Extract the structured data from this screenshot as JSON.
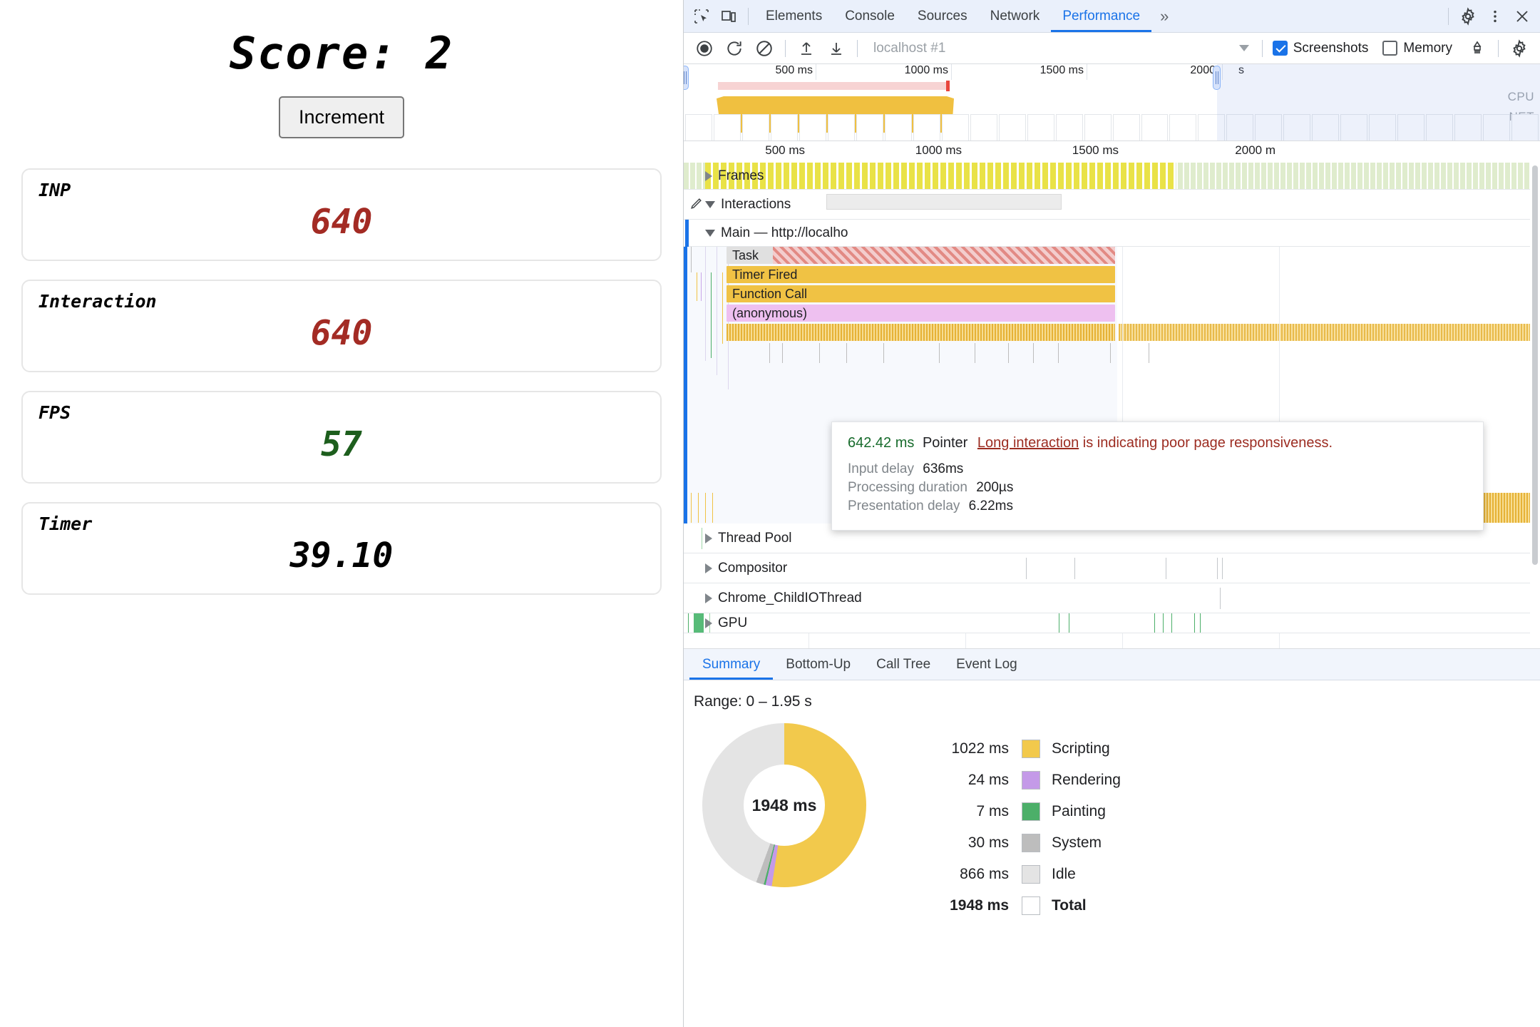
{
  "page": {
    "score_title": "Score: 2",
    "increment_label": "Increment",
    "metrics": [
      {
        "label": "INP",
        "value": "640",
        "color": "#a32b24"
      },
      {
        "label": "Interaction",
        "value": "640",
        "color": "#a32b24"
      },
      {
        "label": "FPS",
        "value": "57",
        "color": "#1d5e1d"
      },
      {
        "label": "Timer",
        "value": "39.10",
        "color": "#000000"
      }
    ]
  },
  "devtools": {
    "tabs": [
      {
        "label": "Elements",
        "active": false
      },
      {
        "label": "Console",
        "active": false
      },
      {
        "label": "Sources",
        "active": false
      },
      {
        "label": "Network",
        "active": false
      },
      {
        "label": "Performance",
        "active": true
      }
    ],
    "more_tabs_label": "»",
    "icons": {
      "inspect": "inspect-element-icon",
      "device": "device-toolbar-icon",
      "settings": "gear-icon",
      "overflow": "three-dot-menu-icon",
      "close": "close-icon",
      "record": "record-icon",
      "reload": "reload-and-record-icon",
      "clear": "clear-icon",
      "load": "load-profile-icon",
      "save": "save-profile-icon",
      "trash": "collect-garbage-icon",
      "capture_settings": "capture-settings-gear-icon"
    },
    "controls": {
      "recording_name": "localhost #1",
      "screenshots_label": "Screenshots",
      "screenshots_checked": true,
      "memory_label": "Memory",
      "memory_checked": false
    },
    "overview": {
      "ticks": [
        "500 ms",
        "1000 ms",
        "1500 ms",
        "2000"
      ],
      "unit_suffix": "s",
      "cpu_label": "CPU",
      "net_label": "NET"
    },
    "flame": {
      "ticks": [
        "500 ms",
        "1000 ms",
        "1500 ms",
        "2000 m"
      ],
      "tracks": [
        {
          "name": "Frames",
          "expanded": false
        },
        {
          "name": "Interactions",
          "expanded": true
        },
        {
          "name": "Main — http://localho",
          "expanded": true
        },
        {
          "name": "Thread Pool",
          "expanded": false
        },
        {
          "name": "Compositor",
          "expanded": false
        },
        {
          "name": "Chrome_ChildIOThread",
          "expanded": false
        },
        {
          "name": "GPU",
          "expanded": false
        }
      ],
      "events": [
        {
          "label": "Task",
          "color": "#e0e0e0"
        },
        {
          "label": "Timer Fired",
          "color": "#f0c244"
        },
        {
          "label": "Function Call",
          "color": "#f0c244"
        },
        {
          "label": "(anonymous)",
          "color": "#eec0f0"
        }
      ]
    },
    "tooltip": {
      "duration": "642.42 ms",
      "event_type": "Pointer",
      "warning_link": "Long interaction",
      "warning_text": "is indicating poor page responsiveness.",
      "rows": [
        {
          "key": "Input delay",
          "value": "636ms"
        },
        {
          "key": "Processing duration",
          "value": "200µs"
        },
        {
          "key": "Presentation delay",
          "value": "6.22ms"
        }
      ]
    },
    "bottom_tabs": [
      {
        "label": "Summary",
        "active": true
      },
      {
        "label": "Bottom-Up",
        "active": false
      },
      {
        "label": "Call Tree",
        "active": false
      },
      {
        "label": "Event Log",
        "active": false
      }
    ],
    "summary": {
      "range_label": "Range: 0 – 1.95 s",
      "donut_center": "1948 ms"
    }
  },
  "chart_data": {
    "type": "pie",
    "title": "Range: 0 – 1.95 s",
    "center_label": "1948 ms",
    "unit": "ms",
    "categories": [
      "Scripting",
      "Rendering",
      "Painting",
      "System",
      "Idle"
    ],
    "values": [
      1022,
      24,
      7,
      30,
      866
    ],
    "labels": [
      "1022 ms",
      "24 ms",
      "7 ms",
      "30 ms",
      "866 ms"
    ],
    "colors": [
      "#f2c94c",
      "#c49ae8",
      "#4caf69",
      "#bdbdbd",
      "#e4e4e4"
    ],
    "total": 1948,
    "total_label": "1948 ms",
    "total_name": "Total",
    "legend_position": "right",
    "grid": false
  }
}
